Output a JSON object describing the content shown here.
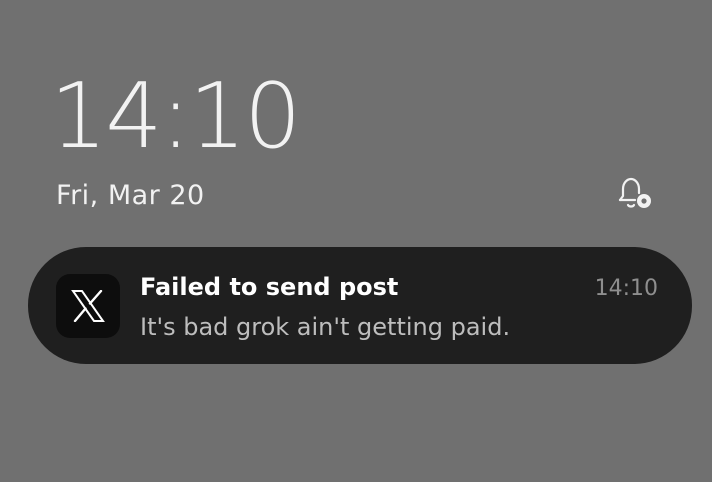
{
  "lockscreen": {
    "time": "14:10",
    "date": "Fri, Mar 20",
    "notification_settings_icon": "bell-gear-icon"
  },
  "notification": {
    "app_icon": "x-logo-icon",
    "title": "Failed to send post",
    "body": "It's bad grok ain't getting paid.",
    "time": "14:10"
  },
  "colors": {
    "background": "#707070",
    "card": "#1f1f1f",
    "primary_text": "#f2f2f2",
    "secondary_text": "#bdbdbd",
    "muted_text": "#8e8e8e"
  }
}
